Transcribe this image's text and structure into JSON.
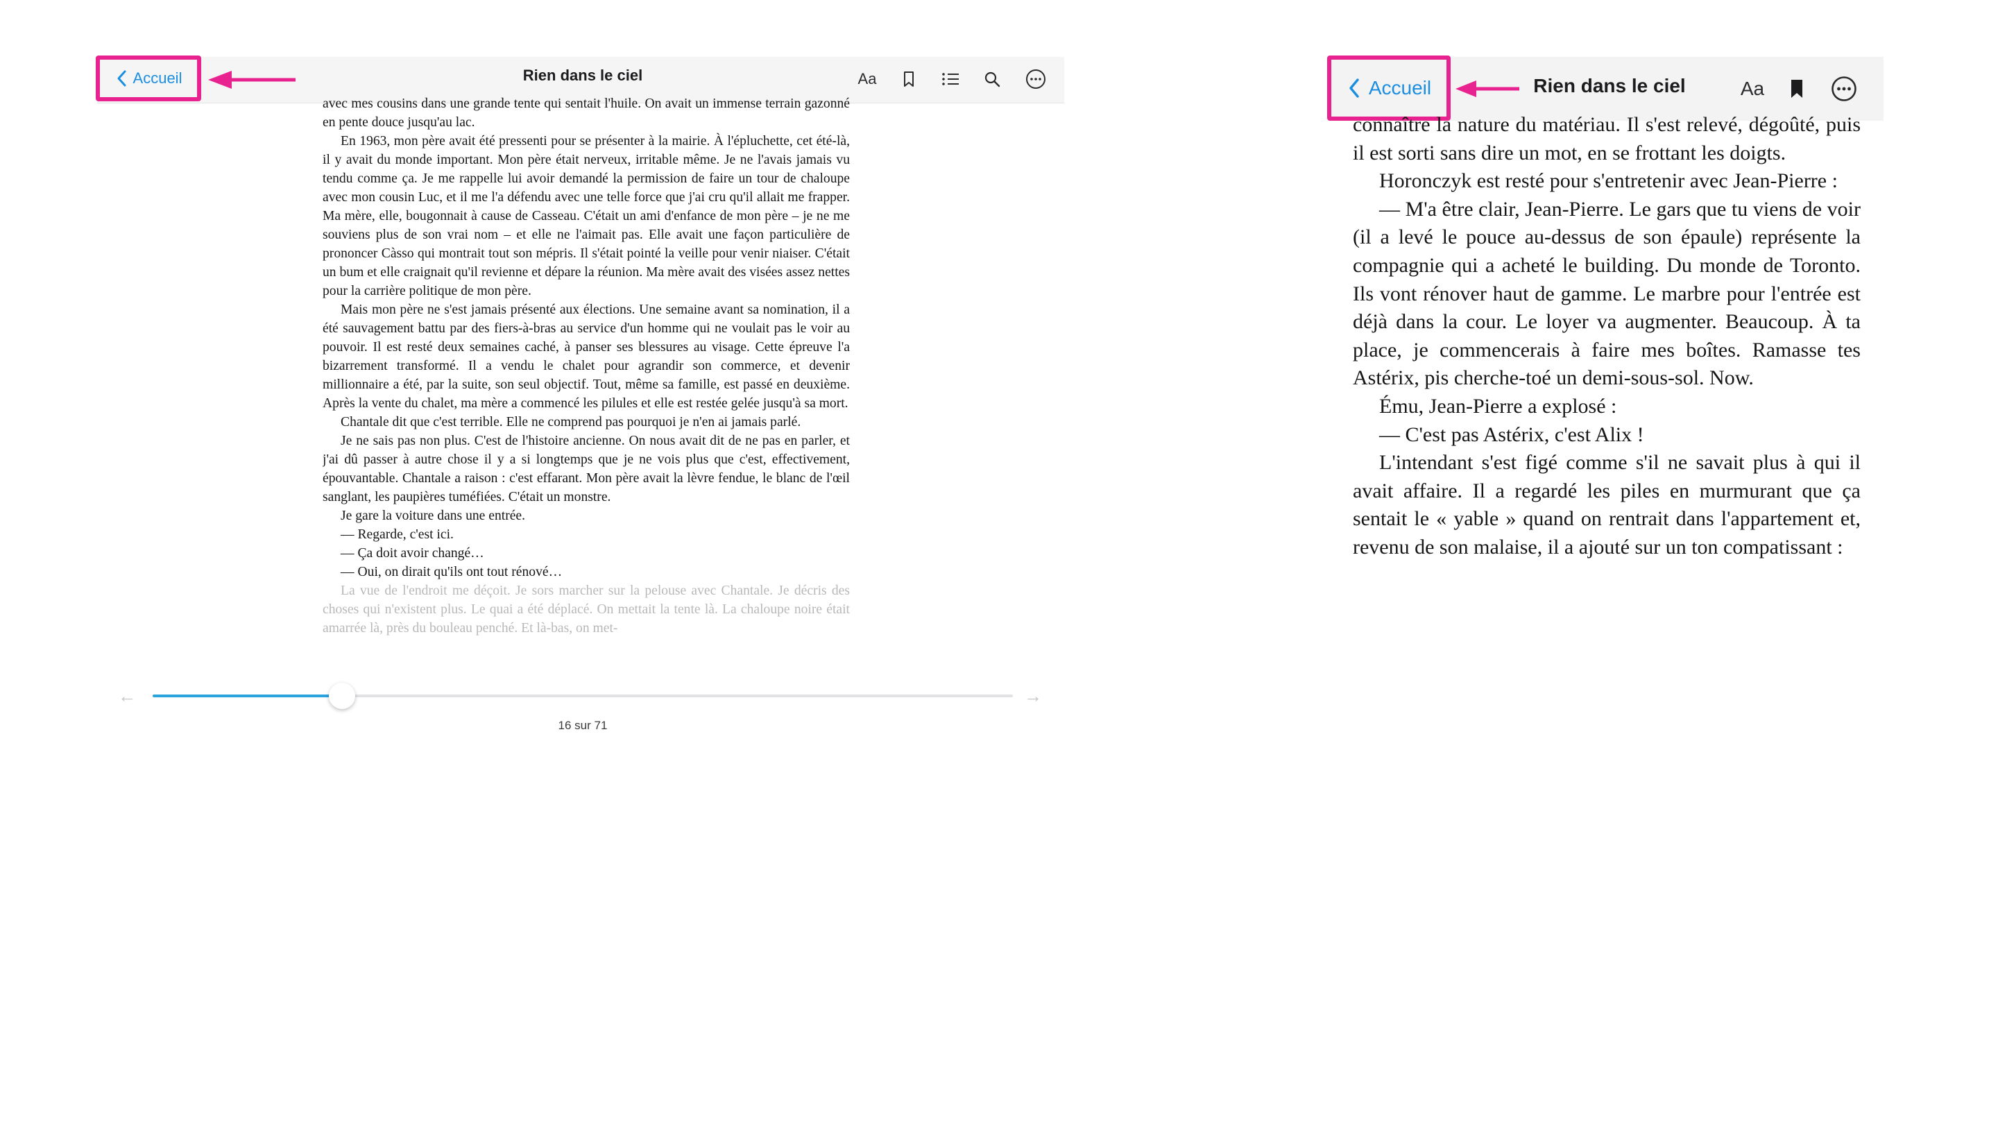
{
  "left": {
    "back_label": "Accueil",
    "title": "Rien dans le ciel",
    "toolbar_icons": [
      "text-size-icon",
      "bookmark-icon",
      "contents-list-icon",
      "search-icon",
      "more-icon"
    ],
    "font_button_label": "Aa",
    "paragraphs": [
      "avec mes cousins dans une grande tente qui sentait l'huile. On avait un immense terrain gazonné en pente douce jusqu'au lac.",
      "En 1963, mon père avait été pressenti pour se présenter à la mairie. À l'épluchette, cet été-là, il y avait du monde important. Mon père était nerveux, irritable même. Je ne l'avais jamais vu tendu comme ça. Je me rappelle lui avoir demandé la permission de faire un tour de chaloupe avec mon cousin Luc, et il me l'a défendu avec une telle force que j'ai cru qu'il allait me frapper. Ma mère, elle, bougonnait à cause de Casseau. C'était un ami d'enfance de mon père – je ne me souviens plus de son vrai nom – et elle ne l'aimait pas. Elle avait une façon particulière de prononcer Càsso qui montrait tout son mépris. Il s'était pointé la veille pour venir niaiser. C'était un bum et elle craignait qu'il revienne et dépare la réunion. Ma mère avait des visées assez nettes pour la carrière politique de mon père.",
      "Mais mon père ne s'est jamais présenté aux élections. Une semaine avant sa nomination, il a été sauvagement battu par des fiers-à-bras au service d'un homme qui ne voulait pas le voir au pouvoir. Il est resté deux semaines caché, à panser ses blessures au visage. Cette épreuve l'a bizarrement transformé. Il a vendu le chalet pour agrandir son commerce, et devenir millionnaire a été, par la suite, son seul objectif. Tout, même sa famille, est passé en deuxième. Après la vente du chalet, ma mère a commencé les pilules et elle est restée gelée jusqu'à sa mort.",
      "Chantale dit que c'est terrible. Elle ne comprend pas pourquoi je n'en ai jamais parlé.",
      "Je ne sais pas non plus. C'est de l'histoire ancienne. On nous avait dit de ne pas en parler, et j'ai dû passer à autre chose il y a si longtemps que je ne vois plus que c'est, effectivement, épouvantable. Chantale a raison : c'est effarant. Mon père avait la lèvre fendue, le blanc de l'œil sanglant, les paupières tuméfiées. C'était un monstre.",
      "Je gare la voiture dans une entrée.",
      "— Regarde, c'est ici.",
      "— Ça doit avoir changé…",
      "— Oui, on dirait qu'ils ont tout rénové…",
      "La vue de l'endroit me déçoit. Je sors marcher sur la pelouse avec Chantale. Je décris des choses qui n'existent plus. Le quai a été déplacé. On mettait la tente là. La chaloupe noire était amarrée là, près du bouleau penché. Et là-bas, on met-"
    ],
    "progress_fraction": 0.22,
    "page_indicator": "16 sur 71"
  },
  "right": {
    "back_label": "Accueil",
    "title": "Rien dans le ciel",
    "font_button_label": "Aa",
    "toolbar_icons": [
      "text-size-icon",
      "bookmark-filled-icon",
      "more-icon"
    ],
    "paragraphs": [
      "connaître la nature du matériau. Il s'est relevé, dégoûté, puis il est sorti sans dire un mot, en se frottant les doigts.",
      "Horonczyk est resté pour s'entretenir avec Jean-Pierre :",
      "— M'a être clair, Jean-Pierre. Le gars que tu viens de voir (il a levé le pouce au-dessus de son épaule) représente la compagnie qui a acheté le building. Du monde de Toronto. Ils vont rénover haut de gamme. Le marbre pour l'entrée est déjà dans la cour. Le loyer va augmenter. Beaucoup. À ta place, je commencerais à faire mes boîtes. Ramasse tes Astérix, pis cherche-toé un demi-sous-sol. Now.",
      "Ému, Jean-Pierre a explosé :",
      "— C'est pas Astérix, c'est Alix !",
      "L'intendant s'est figé comme s'il ne savait plus à qui il avait affaire. Il a regardé les piles en murmurant que ça sentait le « yable » quand on rentrait dans l'appartement et, revenu de son malaise, il a ajouté sur un ton compatissant :"
    ]
  },
  "colors": {
    "highlight": "#e8228f",
    "link": "#1a8ee0",
    "progress": "#2aa3df"
  }
}
